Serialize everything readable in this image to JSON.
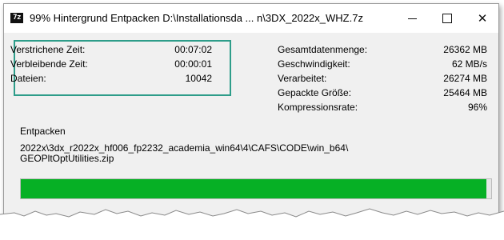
{
  "titlebar": {
    "app_icon": "7z",
    "title": "99% Hintergrund Entpacken D:\\Installationsda ... n\\3DX_2022x_WHZ.7z",
    "icons": [
      "minimize-icon",
      "maximize-icon",
      "close-icon"
    ]
  },
  "stats_left": [
    {
      "label": "Verstrichene Zeit:",
      "value": "00:07:02"
    },
    {
      "label": "Verbleibende Zeit:",
      "value": "00:00:01"
    },
    {
      "label": "Dateien:",
      "value": "10042"
    }
  ],
  "stats_right": [
    {
      "label": "Gesamtdatenmenge:",
      "value": "26362 MB"
    },
    {
      "label": "Geschwindigkeit:",
      "value": "62 MB/s"
    },
    {
      "label": "Verarbeitet:",
      "value": "26274 MB"
    },
    {
      "label": "Gepackte Größe:",
      "value": "25464 MB"
    },
    {
      "label": "Kompressionsrate:",
      "value": "96%"
    }
  ],
  "operation": {
    "label": "Entpacken",
    "path_line1": "2022x\\3dx_r2022x_hf006_fp2232_academia_win64\\4\\CAFS\\CODE\\win_b64\\",
    "path_line2": "GEOPltOptUtilities.zip"
  },
  "progress": {
    "percent": 99,
    "color": "#06b025"
  },
  "colors": {
    "highlight_border": "#2e9d8a"
  }
}
